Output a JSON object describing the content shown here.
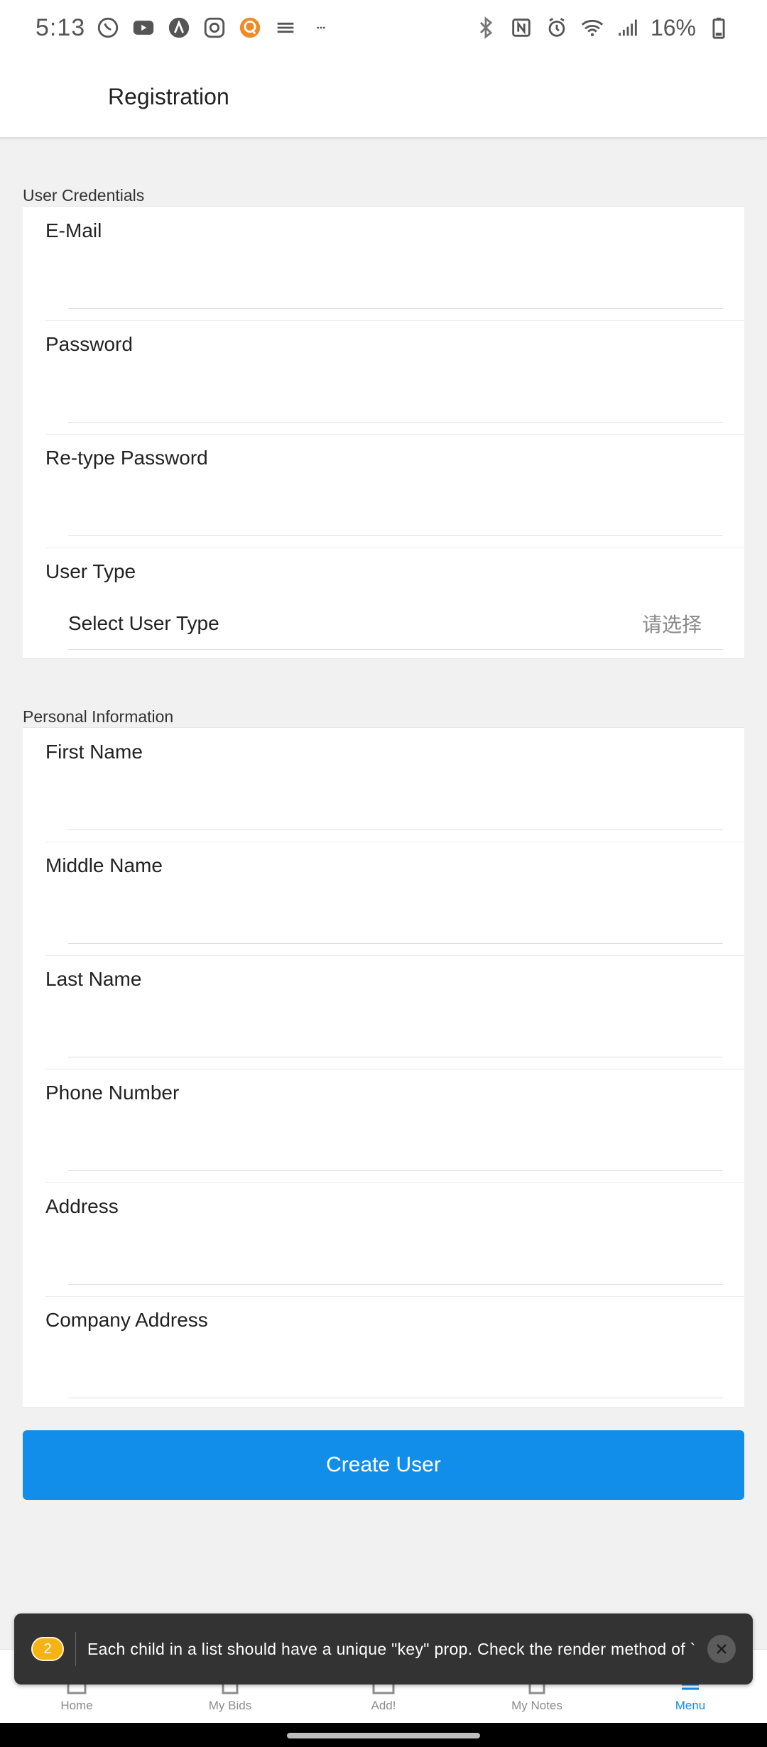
{
  "status_bar": {
    "time": "5:13",
    "battery": "16%",
    "left_icons": [
      "viber-icon",
      "youtube-icon",
      "arch-icon",
      "instagram-icon",
      "q-app-icon",
      "menu-lines-icon",
      "more-dots-icon"
    ],
    "right_icons": [
      "bluetooth-icon",
      "nfc-icon",
      "alarm-icon",
      "wifi-icon",
      "signal-icon",
      "battery-icon"
    ]
  },
  "header": {
    "title": "Registration"
  },
  "credentials": {
    "section_label": "User Credentials",
    "email_label": "E-Mail",
    "password_label": "Password",
    "retype_label": "Re-type Password",
    "user_type_label": "User Type",
    "select_label": "Select User Type",
    "select_placeholder": "请选择"
  },
  "personal": {
    "section_label": "Personal Information",
    "first_name_label": "First Name",
    "middle_name_label": "Middle Name",
    "last_name_label": "Last Name",
    "phone_label": "Phone Number",
    "address_label": "Address",
    "company_address_label": "Company Address"
  },
  "actions": {
    "create_label": "Create User"
  },
  "tabs": [
    {
      "label": "Home",
      "icon": "home-icon"
    },
    {
      "label": "My Bids",
      "icon": "bids-icon"
    },
    {
      "label": "Add!",
      "icon": "add-icon"
    },
    {
      "label": "My Notes",
      "icon": "notes-icon"
    },
    {
      "label": "Menu",
      "icon": "menu-icon",
      "active": true
    }
  ],
  "toast": {
    "count": "2",
    "message": "Each child in a list should have a unique \"key\" prop.  Check the render method of `...",
    "close_icon": "close-icon"
  },
  "colors": {
    "primary": "#118ee9",
    "toast_bg": "#333333",
    "badge": "#f5b316",
    "background": "#f1f1f1"
  }
}
